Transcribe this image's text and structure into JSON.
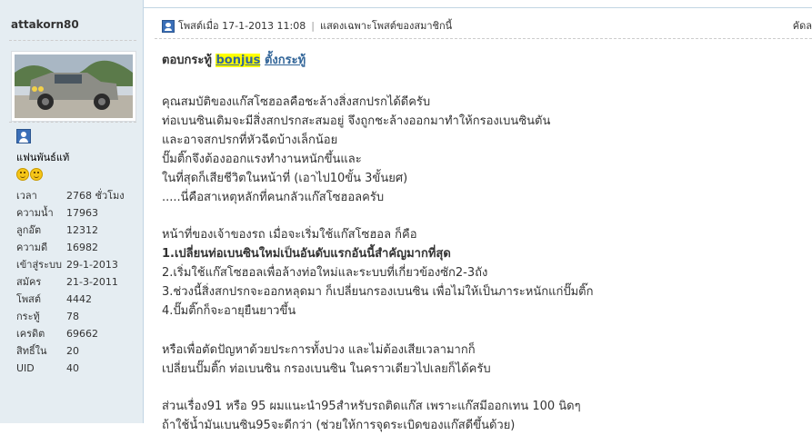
{
  "author": {
    "username": "attakorn80",
    "group_label": "แฟนพันธ์แท้",
    "stats": [
      {
        "label": "เวลา",
        "value": "2768 ชั่วโมง"
      },
      {
        "label": "ความน้ำ",
        "value": "17963"
      },
      {
        "label": "ลูกอ๊ต",
        "value": "12312"
      },
      {
        "label": "ความดี",
        "value": "16982"
      },
      {
        "label": "เข้าสู่ระบบ",
        "value": "29-1-2013"
      },
      {
        "label": "สมัคร",
        "value": "21-3-2011"
      },
      {
        "label": "โพสต์",
        "value": "4442"
      },
      {
        "label": "กระทู้",
        "value": "78"
      },
      {
        "label": "เครดิต",
        "value": "69662"
      },
      {
        "label": "สิทธิ์ใน",
        "value": "20"
      },
      {
        "label": "UID",
        "value": "40"
      }
    ]
  },
  "post": {
    "posted_at": "โพสต์เมื่อ 17-1-2013 11:08",
    "only_author_link": "แสดงเฉพาะโพสต์ของสมาชิกนี้",
    "print_link": "คัดล",
    "reply_prefix": "ตอบกระทู้",
    "reply_user": "bonjus",
    "reply_suffix": "ตั้งกระทู้",
    "paragraphs": [
      [
        "คุณสมบัติของแก๊สโซฮอลคือชะล้างสิ่งสกปรกได้ดีครับ",
        "ท่อเบนซินเดิมจะมีสิ่งสกปรกสะสมอยู่ จึงถูกชะล้างออกมาทำให้กรองเบนซินตัน",
        "และอาจสกปรกที่หัวฉีดบ้างเล็กน้อย",
        "ปั๊มติ๊กจึงต้องออกแรงทำงานหนักขึ้นและ",
        "ในที่สุดก็เสียชีวิตในหน้าที่ (เอาไป10ขั้น 3ขั้นยศ)",
        ".....นี่คือสาเหตุหลักที่คนกลัวแก๊สโซฮอลครับ"
      ],
      [
        "หน้าที่ของเจ้าของรถ เมื่อจะเริ่มใช้แก๊สโซฮอล ก็คือ",
        "1.เปลี่ยนท่อเบนซินใหม่เป็นอันดับแรกอันนี้สำคัญมากที่สุด",
        "2.เริ่มใช้แก๊สโซฮอลเพื่อล้างท่อใหม่และระบบที่เกี่ยวข้องซัก2-3ถัง",
        "3.ช่วงนี้สิ่งสกปรกจะออกหลุดมา ก็เปลี่ยนกรองเบนซิน เพื่อไม่ให้เป็นภาระหนักแก่ปั๊มติ๊ก",
        "4.ปั๊มติ๊กก็จะอายุยืนยาวขึ้น"
      ],
      [
        "หรือเพื่อตัดปัญหาด้วยประการทั้งปวง และไม่ต้องเสียเวลามากก็",
        "เปลี่ยนปั๊มติ๊ก ท่อเบนซิน กรองเบนซิน ในคราวเดียวไปเลยก็ได้ครับ"
      ],
      [
        "ส่วนเรื่อง91 หรือ 95 ผมแนะนำ95สำหรับรถติดแก๊ส เพราะแก๊สมีออกเทน 100 นิดๆ",
        "ถ้าใช้น้ำมันเบนซิน95จะดีกว่า (ช่วยให้การจุดระเบิดของแก๊สดีขึ้นด้วย)"
      ]
    ],
    "bold_line": "1.เปลี่ยนท่อเบนซินใหม่เป็นอันดับแรก"
  },
  "colors": {
    "sidebar_bg": "#e5edf2",
    "link": "#336699",
    "highlight": "#ffff00"
  }
}
